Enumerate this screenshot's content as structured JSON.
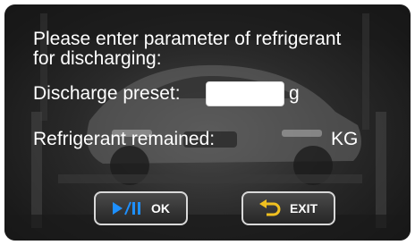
{
  "prompt": {
    "line1": "Please enter parameter of refrigerant",
    "line2": "for discharging:"
  },
  "discharge_preset": {
    "label": "Discharge preset:",
    "value": "",
    "unit": "g"
  },
  "refrigerant_remained": {
    "label": "Refrigerant remained:",
    "value": "",
    "unit": "KG"
  },
  "buttons": {
    "ok": {
      "label": "OK",
      "icon": "play-pause-icon",
      "icon_color": "#1e90ff"
    },
    "exit": {
      "label": "EXIT",
      "icon": "return-arrow-icon",
      "icon_color": "#f0c020"
    }
  }
}
